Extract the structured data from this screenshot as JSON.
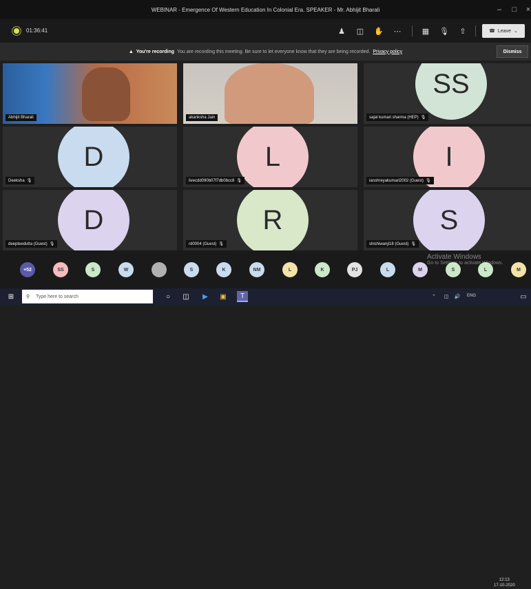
{
  "window": {
    "title": "WEBINAR - Emergence Of Western Education In Colonial Era. SPEAKER - Mr. Abhijit Bharali"
  },
  "toolbar": {
    "timer": "01:36:41",
    "leave_label": "Leave"
  },
  "recording": {
    "heading": "You're recording",
    "message": "You are recording this meeting. Be sure to let everyone know that they are being recorded.",
    "policy_link": "Privacy policy",
    "dismiss_label": "Dismiss"
  },
  "tiles": [
    {
      "name": "Abhijit Bharali",
      "type": "video"
    },
    {
      "name": "akanksha Jain",
      "type": "video"
    },
    {
      "name": "sajal kumari sharma (HEP)",
      "initials": "SS",
      "color": "#d2e4d6"
    },
    {
      "name": "Deeksha",
      "initials": "D",
      "color": "#c9dcef"
    },
    {
      "name": "livecdd090b07f7db0bcc8",
      "initials": "L",
      "color": "#f1c9cd"
    },
    {
      "name": "ianshreyakumari2002 (Guest)",
      "initials": "I",
      "color": "#f1c9cd"
    },
    {
      "name": "deepteedutta (Guest)",
      "initials": "D",
      "color": "#dcd3ee"
    },
    {
      "name": "rd0004 (Guest)",
      "initials": "R",
      "color": "#d9e8c9"
    },
    {
      "name": "shishiwanji18 (Guest)",
      "initials": "S",
      "color": "#dcd3ee"
    }
  ],
  "participants_strip": [
    {
      "label": "+52",
      "color": "#5a5aa8"
    },
    {
      "label": "SS",
      "color": "#f4bcbc"
    },
    {
      "label": "S",
      "color": "#cbe8c8"
    },
    {
      "label": "W",
      "color": "#c9dcef"
    },
    {
      "label": "",
      "color": "#b0b0b0"
    },
    {
      "label": "S",
      "color": "#c9dcef"
    },
    {
      "label": "K",
      "color": "#c9dcef"
    },
    {
      "label": "NM",
      "color": "#c9dcef"
    },
    {
      "label": "L",
      "color": "#f4e3a8"
    },
    {
      "label": "K",
      "color": "#cbe8c8"
    },
    {
      "label": "PJ",
      "color": "#e3e3e3"
    },
    {
      "label": "L",
      "color": "#c9dcef"
    },
    {
      "label": "M",
      "color": "#dcd3ee"
    },
    {
      "label": "S",
      "color": "#cbe8c8"
    },
    {
      "label": "L",
      "color": "#cbe8c8"
    },
    {
      "label": "M",
      "color": "#f4e3a8"
    }
  ],
  "watermark": {
    "line1": "Activate Windows",
    "line2": "Go to Settings to activate Windows."
  },
  "taskbar": {
    "search_placeholder": "Type here to search",
    "time": "12:13",
    "date": "17-10-2020",
    "lang": "ENG"
  }
}
